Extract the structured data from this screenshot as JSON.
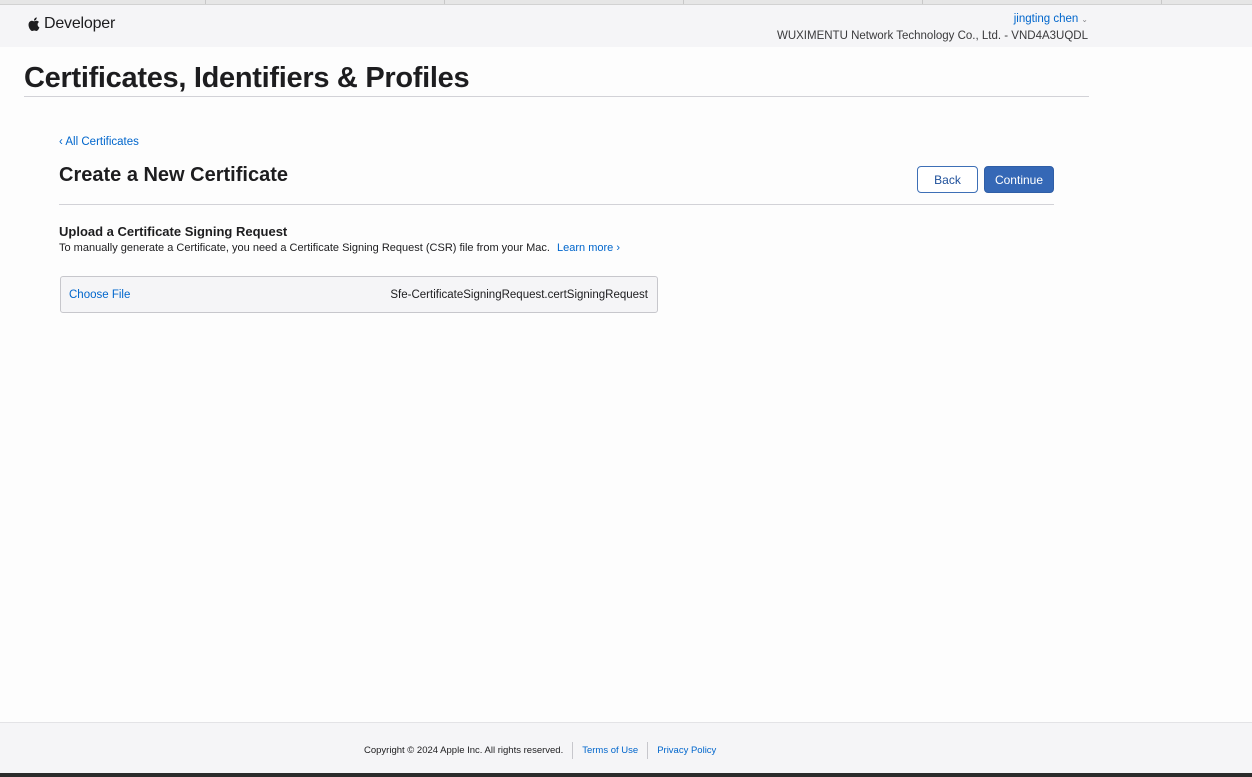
{
  "header": {
    "brand_label": "Developer",
    "account_name": "jingting chen",
    "team_line": "WUXIMENTU Network Technology Co., Ltd. - VND4A3UQDL"
  },
  "page": {
    "title": "Certificates, Identifiers & Profiles"
  },
  "content": {
    "back_link": "‹ All Certificates",
    "section_title": "Create a New Certificate",
    "back_button": "Back",
    "continue_button": "Continue",
    "upload_title": "Upload a Certificate Signing Request",
    "upload_desc": "To manually generate a Certificate, you need a Certificate Signing Request (CSR) file from your Mac.",
    "learn_more": "Learn more ›",
    "choose_file": "Choose File",
    "file_name": "Sfe-CertificateSigningRequest.certSigningRequest"
  },
  "footer": {
    "copyright": "Copyright © 2024 Apple Inc. All rights reserved.",
    "terms": "Terms of Use",
    "privacy": "Privacy Policy"
  },
  "colors": {
    "link": "#0066cc",
    "primary_button": "#3568b6",
    "header_bg": "#f5f5f7"
  },
  "icons": {
    "brand": "apple-logo-icon",
    "account_menu": "chevron-down-icon"
  }
}
